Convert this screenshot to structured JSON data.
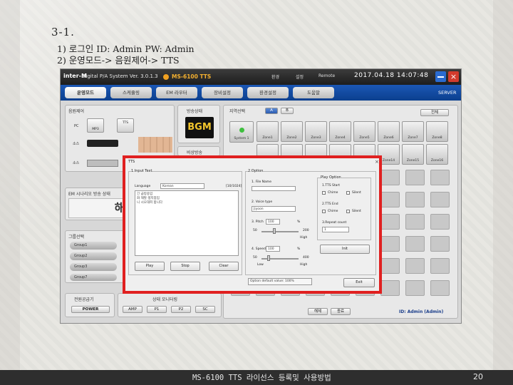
{
  "slide": {
    "title": "3-1.",
    "line1": "1) 로그인 ID: Admin PW: Admin",
    "line2": "2) 운영모드-> 음원제어-> TTS",
    "footer_text": "MS-6100 TTS 라이선스 등록및 사용방법",
    "page_number": "20"
  },
  "app": {
    "logo": "inter-M",
    "app_name": "Digital P/A System Ver. 3.0.1.3",
    "model": "MS-6100 TTS",
    "toolbar": [
      "환경",
      "설정",
      "Remote"
    ],
    "clock": "2017.04.18 14:07:48",
    "close_glyph": "×",
    "tabs": [
      "운영모드",
      "스케쥴링",
      "EM 라우터",
      "장비설정",
      "환경설정",
      "도움말"
    ],
    "server_label": "SERVER",
    "footer_id": "ID: Admin (Admin)"
  },
  "left": {
    "source_label": "음원제어",
    "pc_label": "PC",
    "mp3_label": "MP3",
    "tts_label": "TTS",
    "tuner_label": "소스",
    "remote_label": "소스",
    "bgm_status_label": "방송상태",
    "bgm_text": "BGM",
    "emergency_label": "비상방송",
    "em_message_label": "EM 시나리오 방송 상태",
    "em_value": "해",
    "group_label": "그룹선택",
    "groups": [
      "Group1",
      "Group2",
      "Group3",
      "Group7"
    ],
    "power_label": "전원공급기",
    "power_button": "POWER",
    "status_label": "상태 모니터링",
    "status_buttons": [
      "AMP",
      "P1",
      "P2",
      "SC"
    ]
  },
  "zone_panel": {
    "label": "지역선택",
    "ab": [
      "A",
      "B"
    ],
    "all_button": "전체",
    "system": "System 1",
    "row1": [
      "Zone1",
      "Zone2",
      "Zone3",
      "Zone4",
      "Zone5",
      "Zone6",
      "Zone7",
      "Zone8"
    ],
    "row2": [
      "Zone9",
      "Zone10",
      "Zone11",
      "Zone12",
      "Zone13",
      "Zone14",
      "Zone15",
      "Zone16"
    ],
    "bottom_buttons": [
      "해제",
      "종료"
    ]
  },
  "dialog": {
    "title": "TTS",
    "close": "×",
    "input_text_label": "1.Input Text",
    "language_label": "Language",
    "language_value": "Korean",
    "char_count": "[10/1024]",
    "text_lines": [
      "긴 급방송입",
      "화 재발 생지점입",
      "니 시오대피 합니다"
    ],
    "play": "Play",
    "stop": "Stop",
    "clear": "Clear",
    "option_label": "2.Option",
    "file_name_label": "1. File Name",
    "voice_type_label": "2. Voice type",
    "voice_value": "Jiyoon",
    "pitch_label": "3. Pitch",
    "pitch_value": "100",
    "pitch_unit": "%",
    "pitch_min": "50",
    "pitch_max": "200",
    "pitch_high": "High",
    "speed_label": "4. Speed",
    "speed_value": "100",
    "speed_unit": "%",
    "speed_min": "50",
    "speed_max": "400",
    "speed_low": "Low",
    "speed_high": "High",
    "play_option_label": "Play Option",
    "tts_start_label": "1.TTS Start",
    "tts_end_label": "2.TTS End",
    "chime": "Chime",
    "silent": "Silent",
    "repeat_label": "3.Repeat count",
    "repeat_value": "1",
    "init_button": "Init",
    "default_text": "Option default value: 100%",
    "exit_button": "Exit"
  }
}
